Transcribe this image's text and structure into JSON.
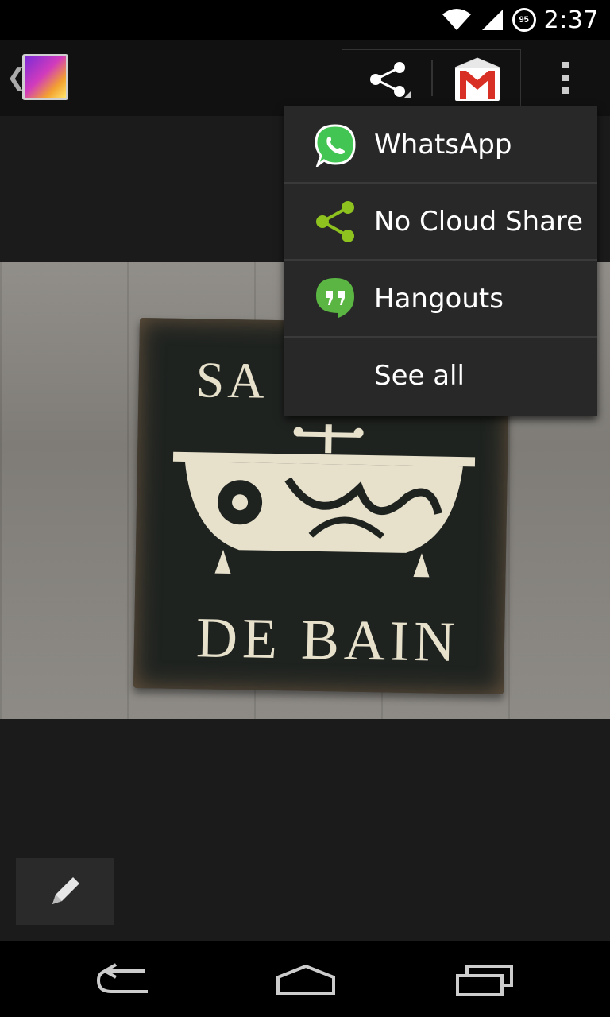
{
  "status_bar": {
    "time": "2:37",
    "battery_level": "95",
    "icons": [
      "wifi-icon",
      "signal-icon",
      "battery-icon"
    ]
  },
  "action_bar": {
    "up_caret": "❮",
    "app_icon": "gallery-icon",
    "share_icon": "share-icon",
    "gmail_icon": "gmail-icon",
    "overflow_icon": "overflow-menu-icon"
  },
  "share_menu": {
    "items": [
      {
        "label": "WhatsApp",
        "icon": "whatsapp-icon"
      },
      {
        "label": "No Cloud Share",
        "icon": "no-cloud-share-icon"
      },
      {
        "label": "Hangouts",
        "icon": "hangouts-icon"
      },
      {
        "label": "See all",
        "icon": ""
      }
    ]
  },
  "photo": {
    "sign_line1": "SA",
    "sign_line2": "DE BAIN"
  },
  "edit_button": {
    "icon": "pencil-icon"
  },
  "nav_bar": {
    "back_icon": "back-icon",
    "home_icon": "home-icon",
    "recents_icon": "recents-icon"
  },
  "colors": {
    "status_bar": "#000000",
    "action_bar": "#111111",
    "background": "#1b1b1b",
    "menu_bg": "#282828",
    "whatsapp_green": "#43c553",
    "share_green": "#8dc21f",
    "hangouts_green": "#5bb543"
  }
}
